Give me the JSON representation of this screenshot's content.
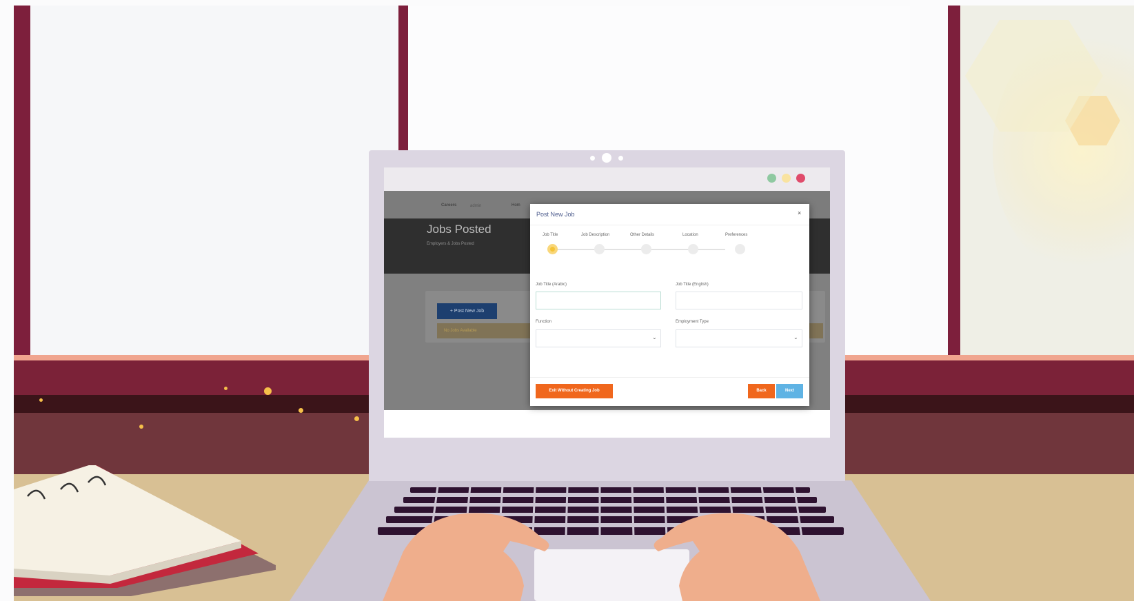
{
  "colors": {
    "frame": "#7d1f3c",
    "accent_orange": "#f0671d",
    "accent_blue": "#5fb3e4",
    "traffic_green": "#8fc9a1",
    "traffic_yellow": "#f9e3a0",
    "traffic_red": "#e04b6b"
  },
  "browser": {
    "traffic_lights": [
      "green",
      "yellow",
      "red"
    ]
  },
  "app": {
    "logo": "Careers",
    "nav_admin": "admin",
    "nav_home": "Hom",
    "page_title": "Jobs Posted",
    "page_subtitle": "Employers & Jobs Posted",
    "post_button": "+ Post New Job",
    "no_jobs": "No Jobs Available"
  },
  "modal": {
    "title": "Post New Job",
    "close": "×",
    "steps": [
      {
        "label": "Job Title",
        "active": true
      },
      {
        "label": "Job Description",
        "active": false
      },
      {
        "label": "Other Details",
        "active": false
      },
      {
        "label": "Location",
        "active": false
      },
      {
        "label": "Preferences",
        "active": false
      }
    ],
    "fields": {
      "job_title_arabic": {
        "label": "Job Title (Arabic)",
        "value": ""
      },
      "job_title_english": {
        "label": "Job Title (English)",
        "value": ""
      },
      "function": {
        "label": "Function",
        "value": ""
      },
      "employment_type": {
        "label": "Employment Type",
        "value": ""
      }
    },
    "buttons": {
      "exit": "Exit Without Creating Job",
      "back": "Back",
      "next": "Next"
    }
  }
}
